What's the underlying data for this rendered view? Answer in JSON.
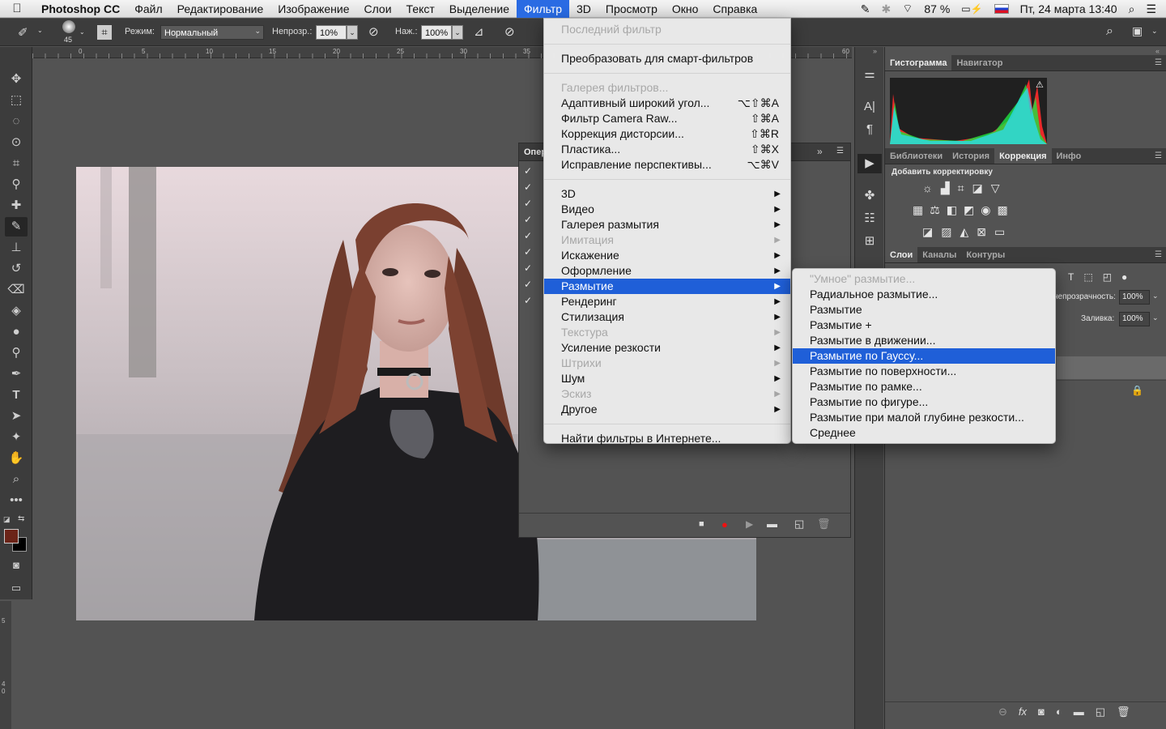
{
  "menubar": {
    "app": "Photoshop CC",
    "items": [
      "Файл",
      "Редактирование",
      "Изображение",
      "Слои",
      "Текст",
      "Выделение",
      "Фильтр",
      "3D",
      "Просмотр",
      "Окно",
      "Справка"
    ],
    "active_index": 6,
    "battery": "87 %",
    "clock": "Пт, 24 марта  13:40"
  },
  "options": {
    "brush_size": "45",
    "mode_label": "Режим:",
    "mode_value": "Нормальный",
    "opacity_label": "Непрозр.:",
    "opacity_value": "10%",
    "flow_label": "Наж.:",
    "flow_value": "100%"
  },
  "ruler_h": [
    "0",
    "5",
    "10",
    "15",
    "20",
    "25",
    "30",
    "35",
    "60"
  ],
  "ruler_v": [
    "5",
    "4 0"
  ],
  "actions_panel": {
    "title_fragment": "Опер"
  },
  "right": {
    "top_tabs": [
      "Гистограмма",
      "Навигатор"
    ],
    "mid_tabs": [
      "Библиотеки",
      "История",
      "Коррекция",
      "Инфо"
    ],
    "adjust_title": "Добавить корректировку",
    "layers_tabs": [
      "Слои",
      "Каналы",
      "Контуры"
    ],
    "opacity_label": "непрозрачность:",
    "opacity_value": "100%",
    "fill_label": "Заливка:",
    "fill_value": "100%"
  },
  "filter_menu": [
    {
      "label": "Последний фильтр",
      "shortcut": "",
      "disabled": true
    },
    {
      "sep": true
    },
    {
      "label": "Преобразовать для смарт-фильтров",
      "shortcut": ""
    },
    {
      "sep": true
    },
    {
      "label": "Галерея фильтров...",
      "disabled": true
    },
    {
      "label": "Адаптивный широкий угол...",
      "shortcut": "⌥⇧⌘A"
    },
    {
      "label": "Фильтр Camera Raw...",
      "shortcut": "⇧⌘A"
    },
    {
      "label": "Коррекция дисторсии...",
      "shortcut": "⇧⌘R"
    },
    {
      "label": "Пластика...",
      "shortcut": "⇧⌘X"
    },
    {
      "label": "Исправление перспективы...",
      "shortcut": "⌥⌘V"
    },
    {
      "sep": true
    },
    {
      "label": "3D",
      "submenu": true
    },
    {
      "label": "Видео",
      "submenu": true
    },
    {
      "label": "Галерея размытия",
      "submenu": true
    },
    {
      "label": "Имитация",
      "submenu": true,
      "disabled": true
    },
    {
      "label": "Искажение",
      "submenu": true
    },
    {
      "label": "Оформление",
      "submenu": true
    },
    {
      "label": "Размытие",
      "submenu": true,
      "highlighted": true
    },
    {
      "label": "Рендеринг",
      "submenu": true
    },
    {
      "label": "Стилизация",
      "submenu": true
    },
    {
      "label": "Текстура",
      "submenu": true,
      "disabled": true
    },
    {
      "label": "Усиление резкости",
      "submenu": true
    },
    {
      "label": "Штрихи",
      "submenu": true,
      "disabled": true
    },
    {
      "label": "Шум",
      "submenu": true
    },
    {
      "label": "Эскиз",
      "submenu": true,
      "disabled": true
    },
    {
      "label": "Другое",
      "submenu": true
    },
    {
      "sep": true
    },
    {
      "label": "Найти фильтры в Интернете..."
    }
  ],
  "blur_submenu": [
    {
      "label": "\"Умное\" размытие...",
      "disabled": true
    },
    {
      "label": "Радиальное размытие..."
    },
    {
      "label": "Размытие"
    },
    {
      "label": "Размытие +"
    },
    {
      "label": "Размытие в движении..."
    },
    {
      "label": "Размытие по Гауссу...",
      "highlighted": true
    },
    {
      "label": "Размытие по поверхности..."
    },
    {
      "label": "Размытие по рамке..."
    },
    {
      "label": "Размытие по фигуре..."
    },
    {
      "label": "Размытие при малой глубине резкости..."
    },
    {
      "label": "Среднее"
    }
  ],
  "colors": {
    "foreground": "#6b2418",
    "background": "#000000",
    "highlight": "#1f5fd8"
  }
}
